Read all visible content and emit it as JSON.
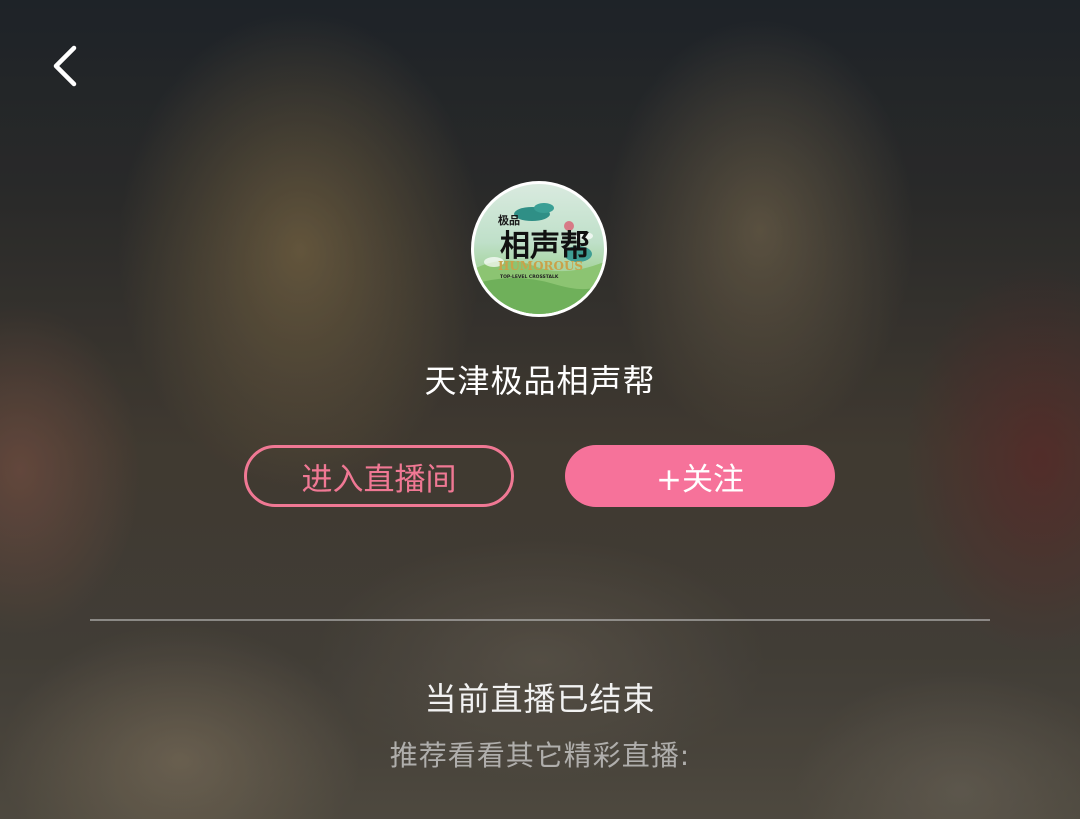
{
  "header": {
    "back_icon": "chevron-left-icon"
  },
  "anchor": {
    "avatar_logo_text": "极品 相声帮 HUMOROUS TOP-LEVEL CROSSTALK",
    "name": "天津极品相声帮"
  },
  "actions": {
    "enter_label": "进入直播间",
    "follow_label": "+关注"
  },
  "status": {
    "ended_text": "当前直播已结束",
    "recommend_text": "推荐看看其它精彩直播:"
  },
  "colors": {
    "accent": "#f6729a",
    "accent_outline": "#f07894"
  }
}
